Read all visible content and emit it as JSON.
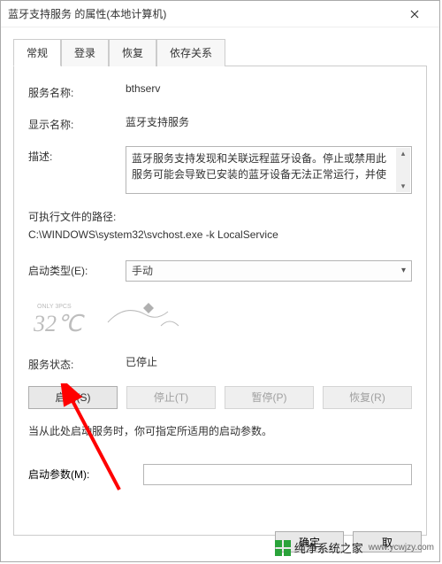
{
  "window": {
    "title": "蓝牙支持服务 的属性(本地计算机)"
  },
  "tabs": {
    "items": [
      {
        "label": "常规",
        "active": true
      },
      {
        "label": "登录",
        "active": false
      },
      {
        "label": "恢复",
        "active": false
      },
      {
        "label": "依存关系",
        "active": false
      }
    ]
  },
  "fields": {
    "service_name_label": "服务名称:",
    "service_name_value": "bthserv",
    "display_name_label": "显示名称:",
    "display_name_value": "蓝牙支持服务",
    "desc_label": "描述:",
    "desc_value": "蓝牙服务支持发现和关联远程蓝牙设备。停止或禁用此服务可能会导致已安装的蓝牙设备无法正常运行，并使",
    "path_label": "可执行文件的路径:",
    "path_value": "C:\\WINDOWS\\system32\\svchost.exe -k LocalService",
    "startup_type_label": "启动类型(E):",
    "startup_type_value": "手动",
    "status_label": "服务状态:",
    "status_value": "已停止"
  },
  "buttons": {
    "start": "启动(S)",
    "stop": "停止(T)",
    "pause": "暂停(P)",
    "resume": "恢复(R)"
  },
  "note": "当从此处启动服务时，你可指定所适用的启动参数。",
  "param": {
    "label": "启动参数(M):",
    "value": ""
  },
  "dialog_buttons": {
    "ok": "确定",
    "cancel": "取"
  },
  "site_watermark": {
    "name": "纯净系统之家",
    "url": "www.ycwjzy.com"
  }
}
